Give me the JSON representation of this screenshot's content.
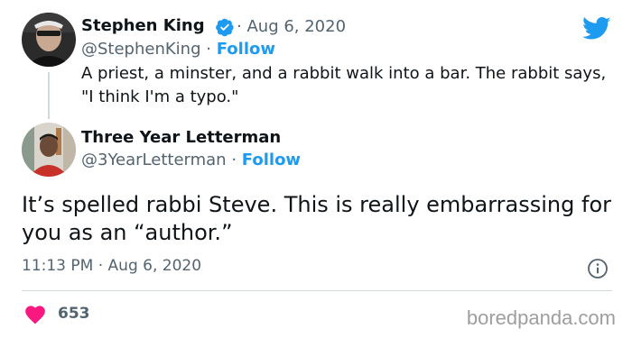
{
  "original_tweet": {
    "author_name": "Stephen King",
    "verified": true,
    "separator": "·",
    "date": "Aug 6, 2020",
    "handle": "@StephenKing",
    "follow_label": "Follow",
    "text": "A priest, a minster, and a rabbit walk into a bar. The rabbit says, \"I think I'm a typo.\""
  },
  "reply_tweet": {
    "author_name": "Three Year Letterman",
    "handle": "@3YearLetterman",
    "separator": "·",
    "follow_label": "Follow",
    "text": "It’s spelled rabbi Steve. This is really embarrassing for you as an “author.”",
    "time": "11:13 PM",
    "date": "Aug 6, 2020",
    "like_count": "653"
  },
  "icons": {
    "verified": "verified-badge-icon",
    "twitter": "twitter-bird-icon",
    "info": "info-icon",
    "like": "heart-icon"
  },
  "colors": {
    "accent": "#1d9bf0",
    "heart": "#f91880",
    "text": "#0f1419",
    "secondary": "#536471"
  },
  "watermark": "boredpanda.com"
}
